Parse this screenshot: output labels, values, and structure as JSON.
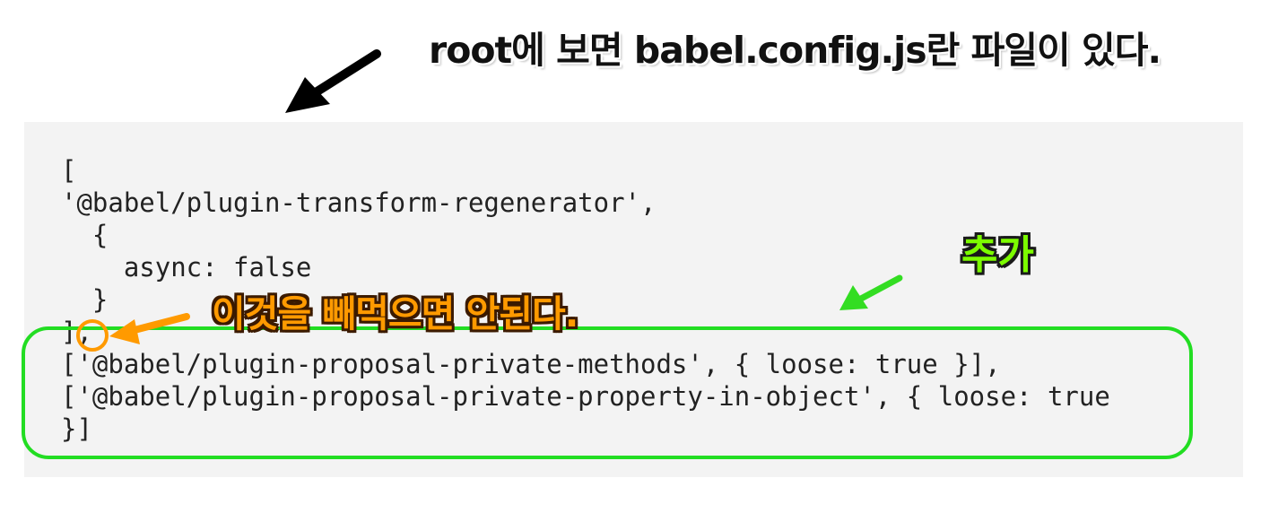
{
  "annotations": {
    "title": "root에 보면 babel.config.js란 파일이 있다.",
    "add_label": "추가",
    "warning_label": "이것을 빼먹으면 안된다.",
    "colors": {
      "highlight_box": "#22dd22",
      "add_label_fill": "#7cfc00",
      "warning_fill": "#ff9a00",
      "code_background": "#f3f3f3",
      "arrow_black": "#000000",
      "arrow_green": "#33dd22",
      "arrow_orange": "#ff9a00"
    }
  },
  "code": {
    "lines": [
      "[",
      "'@babel/plugin-transform-regenerator',",
      "  {",
      "    async: false",
      "  }",
      "],",
      "['@babel/plugin-proposal-private-methods', { loose: true }],",
      "['@babel/plugin-proposal-private-property-in-object', { loose: true",
      "}]"
    ]
  }
}
